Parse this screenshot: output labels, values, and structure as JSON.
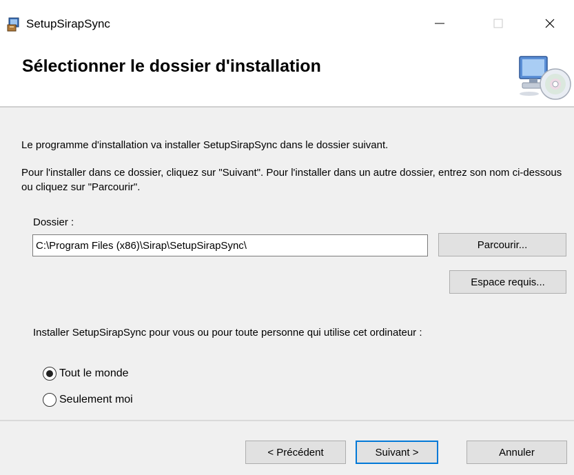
{
  "window": {
    "title": "SetupSirapSync",
    "minimize_glyph": "—",
    "maximize_glyph": "☐",
    "close_glyph": "✕"
  },
  "header": {
    "title": "Sélectionner le dossier d'installation",
    "icon": "computer-cd-icon"
  },
  "content": {
    "intro": "Le programme d'installation va installer SetupSirapSync dans le dossier suivant.",
    "instructions": "Pour l'installer dans ce dossier, cliquez sur \"Suivant\". Pour l'installer dans un autre dossier, entrez son nom ci-dessous ou cliquez sur \"Parcourir\".",
    "folder_label": "Dossier :",
    "folder_value": "C:\\Program Files (x86)\\Sirap\\SetupSirapSync\\",
    "browse_button": "Parcourir...",
    "space_button": "Espace requis...",
    "scope_question": "Installer SetupSirapSync pour vous ou pour toute personne qui utilise cet ordinateur :",
    "radio_everyone": "Tout le monde",
    "radio_only_me": "Seulement moi",
    "selected_option": "everyone"
  },
  "footer": {
    "prev_button": "< Précédent",
    "next_button": "Suivant >",
    "cancel_button": "Annuler"
  },
  "colors": {
    "dialog_background": "#f0f0f0",
    "header_background": "#ffffff",
    "default_button_border": "#0078d7"
  }
}
